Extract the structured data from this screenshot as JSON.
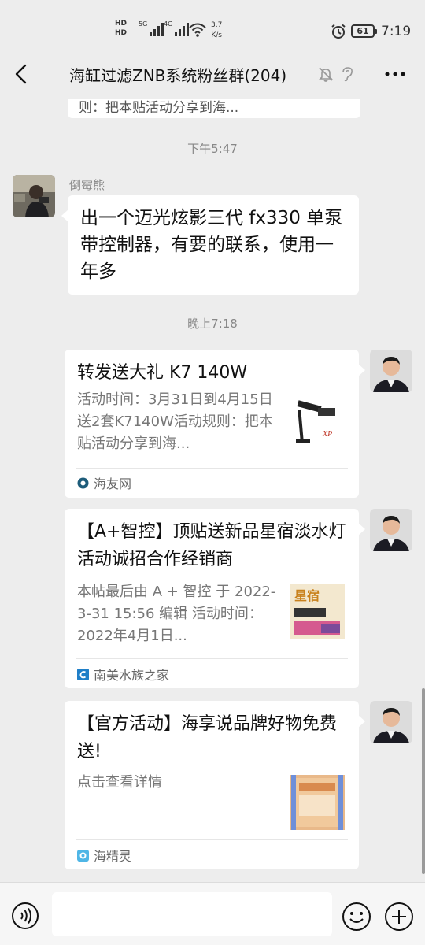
{
  "status_bar": {
    "hd1": "HD",
    "hd2": "HD",
    "sig1_label": "5G",
    "sig2_label": "4G",
    "speed_value": "3.7",
    "speed_unit": "K/s",
    "battery": "61",
    "time": "7:19"
  },
  "nav": {
    "title": "海缸过滤ZNB系统粉丝群(204)",
    "icons": [
      "back-icon",
      "mute-bell-icon",
      "ear-icon",
      "more-icon"
    ]
  },
  "chat": {
    "partial_card_text": "则：把本贴活动分享到海...",
    "timestamp_1": "下午5:47",
    "message_1": {
      "sender": "倒霉熊",
      "text": "出一个迈光炫影三代 fx330 单泵带控制器，有要的联系，使用一年多"
    },
    "timestamp_2": "晚上7:18",
    "cards": [
      {
        "title": "转发送大礼 K7 140W",
        "desc": "活动时间：3月31日到4月15日送2套K7140W活动规则：把本贴活动分享到海...",
        "source": "海友网",
        "thumb_text": "XP"
      },
      {
        "title": "【A+智控】顶贴送新品星宿淡水灯活动诚招合作经销商",
        "desc": "本帖最后由 A + 智控 于 2022-3-31 15:56 编辑 活动时间：2022年4月1日...",
        "source": "南美水族之家",
        "thumb_text": "星宿"
      },
      {
        "title": "【官方活动】海享说品牌好物免费送!",
        "desc": "点击查看详情",
        "source": "海精灵"
      }
    ]
  },
  "input_bar": {
    "icons": [
      "voice-icon",
      "emoji-icon",
      "plus-icon"
    ]
  },
  "colors": {
    "background": "#ededed",
    "bubble": "#ffffff",
    "timestamp": "#888888"
  }
}
